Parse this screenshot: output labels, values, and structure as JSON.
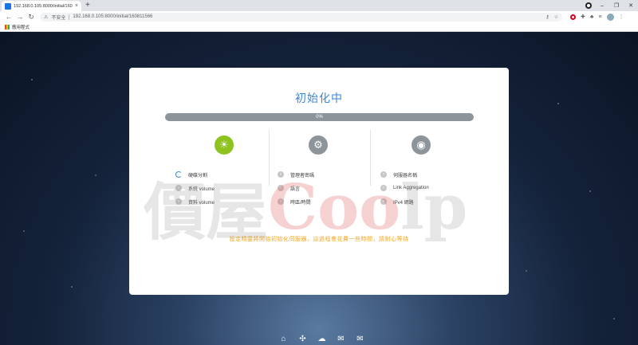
{
  "browser": {
    "tab_title": "192.168.0.105:8000/initial/160",
    "tab_close": "×",
    "new_tab": "+",
    "insecure_label": "不安全",
    "url": "192.168.0.105:8000/initial/160811566",
    "bookmarks_label": "應用程式"
  },
  "setup": {
    "title": "初始化中",
    "progress_text": "0%",
    "progress_value": 0,
    "columns": [
      {
        "icon": "sunrise-icon",
        "state": "active",
        "steps": [
          "硬碟分割",
          "系統 volume",
          "資料 volume"
        ]
      },
      {
        "icon": "gear-icon",
        "state": "idle",
        "steps": [
          "管理者密碼",
          "語言",
          "時區/時間"
        ]
      },
      {
        "icon": "globe-icon",
        "state": "idle",
        "steps": [
          "伺服器名稱",
          "Link Aggregation",
          "IPv4 網路"
        ]
      }
    ],
    "notice": "設定精靈將開始初始化伺服器，這過程會花費一些時間，請耐心等待"
  },
  "watermark": {
    "left": "價屋",
    "oo": "Coo",
    "right": "lp"
  },
  "dock_icons": [
    "bank-icon",
    "puzzle-icon",
    "cloud-download-icon",
    "chat-icon",
    "mail-icon"
  ],
  "colors": {
    "accent": "#3a87d6",
    "active": "#8dc21f",
    "idle": "#8d959b",
    "notice": "#f5a623"
  }
}
